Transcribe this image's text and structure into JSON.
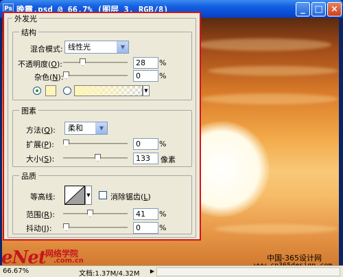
{
  "window": {
    "title": "晚霞.psd @ 66.7% (图层 3, RGB/8)",
    "app_icon": "Ps",
    "minimize_icon": "minimize-icon",
    "maximize_icon": "maximize-icon",
    "close_icon": "close-icon"
  },
  "dialog": {
    "title": "外发光",
    "structure": {
      "legend": "结构",
      "blend_mode_label": "混合模式:",
      "blend_mode_value": "线性光",
      "opacity_label": "不透明度",
      "opacity_key": "O",
      "opacity_value": "28",
      "opacity_unit": "%",
      "opacity_level": 0.28,
      "noise_label": "杂色",
      "noise_key": "N",
      "noise_value": "0",
      "noise_unit": "%",
      "noise_level": 0,
      "solid_color": "#fff5b8",
      "solid_selected": true,
      "gradient_selected": false
    },
    "elements": {
      "legend": "图素",
      "technique_label": "方法",
      "technique_key": "Q",
      "technique_value": "柔和",
      "spread_label": "扩展",
      "spread_key": "P",
      "spread_value": "0",
      "spread_unit": "%",
      "spread_level": 0,
      "size_label": "大小",
      "size_key": "S",
      "size_value": "133",
      "size_unit": "像素",
      "size_level": 0.54
    },
    "quality": {
      "legend": "品质",
      "contour_label": "等高线:",
      "antialias_label": "消除锯齿",
      "antialias_key": "L",
      "antialias_checked": false,
      "range_label": "范围",
      "range_key": "R",
      "range_value": "41",
      "range_unit": "%",
      "range_level": 0.41,
      "jitter_label": "抖动",
      "jitter_key": "J",
      "jitter_value": "0",
      "jitter_unit": "%",
      "jitter_level": 0
    }
  },
  "watermark": {
    "logo": "eNet",
    "logo_cn": "网络学院",
    "logo_com": ".com.cn",
    "site_cn": "中国-365设计网",
    "site_url": "www.cn365design.com"
  },
  "status": {
    "zoom": "66.67%",
    "doc_info": "文档:1.37M/4.32M"
  }
}
